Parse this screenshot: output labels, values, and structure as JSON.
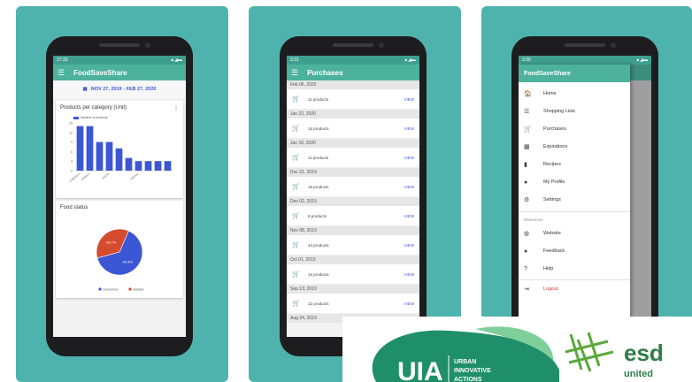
{
  "colors": {
    "card": "#4fb3ad",
    "appbar": "#4cb29c",
    "accent": "#3b57d6",
    "wasted": "#d44b2f"
  },
  "phone1": {
    "status_time": "17:33",
    "app_title": "FoodSaveShare",
    "date_range": "NOV 27, 2019 - FEB 27, 2020",
    "products_panel_title": "Products per category (Unit)",
    "food_status_title": "Food status"
  },
  "chart_data": [
    {
      "type": "bar",
      "title": "Products per category (Unit)",
      "series": [
        {
          "name": "Number of products",
          "values": [
            14,
            14,
            9,
            9,
            7,
            4,
            3,
            3,
            3,
            3
          ]
        }
      ],
      "categories": [
        "CHEESES",
        "DRINKS",
        "",
        "PASTA",
        "",
        "",
        "CREAM",
        "",
        "",
        ""
      ],
      "ylim": [
        0,
        15
      ],
      "yticks": [
        0,
        3,
        6,
        9,
        12,
        15
      ]
    },
    {
      "type": "pie",
      "title": "Food status",
      "labels": [
        "consumed",
        "wasted"
      ],
      "values": [
        64.3,
        35.7
      ],
      "value_labels": [
        "64.3%",
        "35.7%"
      ]
    }
  ],
  "phone2": {
    "status_time": "3:31",
    "title": "Purchases",
    "view_label": "VIEW",
    "groups": [
      {
        "date": "Feb 06, 2020",
        "count": "11 products"
      },
      {
        "date": "Jan 22, 2020",
        "count": "16 products"
      },
      {
        "date": "Jan 16, 2020",
        "count": "11 products"
      },
      {
        "date": "Dec 21, 2019",
        "count": "18 products"
      },
      {
        "date": "Dec 02, 2019",
        "count": "8 products"
      },
      {
        "date": "Nov 08, 2019",
        "count": "24 products"
      },
      {
        "date": "Oct 01, 2019",
        "count": "16 products"
      },
      {
        "date": "Sep 13, 2019",
        "count": "12 products"
      },
      {
        "date": "Aug 24, 2019",
        "count": ""
      }
    ]
  },
  "phone3": {
    "status_time": "3:30",
    "drawer_title": "FoodSaveShare",
    "items": [
      {
        "label": "Home",
        "icon": "home-icon",
        "glyph": "🏠"
      },
      {
        "label": "Shopping Lists",
        "icon": "list-icon",
        "glyph": "☰"
      },
      {
        "label": "Purchases",
        "icon": "cart-icon",
        "glyph": "🛒"
      },
      {
        "label": "Expirations",
        "icon": "calendar-icon",
        "glyph": "▦"
      },
      {
        "label": "Recipes",
        "icon": "book-icon",
        "glyph": "▮"
      },
      {
        "label": "My Profile",
        "icon": "account-icon",
        "glyph": "●"
      },
      {
        "label": "Settings",
        "icon": "gear-icon",
        "glyph": "⚙"
      }
    ],
    "resources_label": "Resources",
    "resource_items": [
      {
        "label": "Website",
        "icon": "globe-icon",
        "glyph": "◍"
      },
      {
        "label": "Feedback",
        "icon": "chat-icon",
        "glyph": "●"
      },
      {
        "label": "Help",
        "icon": "help-icon",
        "glyph": "?"
      }
    ],
    "logout_label": "Logout"
  },
  "logos": {
    "uia_mark": "UIA",
    "uia_text": "URBAN INNOVATIVE ACTIONS",
    "esd_text": "esd",
    "esd_sub": "united"
  }
}
